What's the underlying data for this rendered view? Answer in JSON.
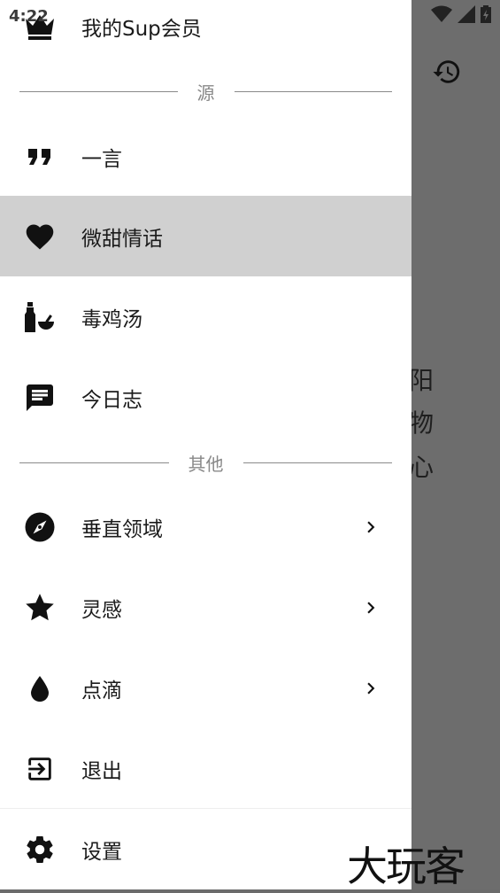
{
  "status_bar": {
    "time": "4:22"
  },
  "background": {
    "text_lines": [
      "阳",
      "物",
      "心"
    ]
  },
  "drawer": {
    "membership_label": "我的Sup会员",
    "section_source": "源",
    "source_items": [
      {
        "label": "一言",
        "icon": "quote-icon"
      },
      {
        "label": "微甜情话",
        "icon": "heart-icon",
        "selected": true
      },
      {
        "label": "毒鸡汤",
        "icon": "bottle-icon"
      },
      {
        "label": "今日志",
        "icon": "chat-icon"
      }
    ],
    "section_other": "其他",
    "other_items": [
      {
        "label": "垂直领域",
        "icon": "compass-icon"
      },
      {
        "label": "灵感",
        "icon": "star-icon"
      },
      {
        "label": "点滴",
        "icon": "drop-icon"
      }
    ],
    "logout_label": "退出",
    "settings_label": "设置"
  },
  "watermark": "大玩客"
}
